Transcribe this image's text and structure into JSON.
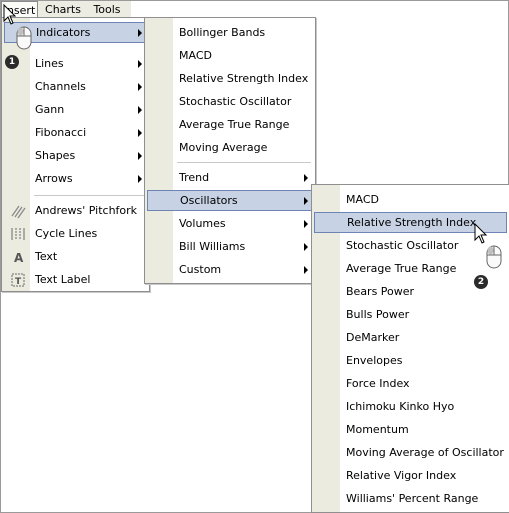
{
  "menubar": {
    "items": [
      "Insert",
      "Charts",
      "Tools"
    ]
  },
  "insert_menu": {
    "items": [
      {
        "label": "Indicators",
        "submenu": true,
        "highlighted": true
      },
      {
        "label": "Lines",
        "submenu": true
      },
      {
        "label": "Channels",
        "submenu": true
      },
      {
        "label": "Gann",
        "submenu": true
      },
      {
        "label": "Fibonacci",
        "submenu": true
      },
      {
        "label": "Shapes",
        "submenu": true
      },
      {
        "label": "Arrows",
        "submenu": true
      },
      {
        "label": "Andrews' Pitchfork",
        "icon": "pitchfork-icon"
      },
      {
        "label": "Cycle Lines",
        "icon": "cycle-lines-icon"
      },
      {
        "label": "Text",
        "icon": "text-icon"
      },
      {
        "label": "Text Label",
        "icon": "text-label-icon"
      }
    ]
  },
  "indicators_menu": {
    "items": [
      {
        "label": "Bollinger Bands"
      },
      {
        "label": "MACD"
      },
      {
        "label": "Relative Strength Index"
      },
      {
        "label": "Stochastic Oscillator"
      },
      {
        "label": "Average True Range"
      },
      {
        "label": "Moving Average"
      },
      {
        "label": "Trend",
        "submenu": true
      },
      {
        "label": "Oscillators",
        "submenu": true,
        "highlighted": true
      },
      {
        "label": "Volumes",
        "submenu": true
      },
      {
        "label": "Bill Williams",
        "submenu": true
      },
      {
        "label": "Custom",
        "submenu": true
      }
    ]
  },
  "oscillators_menu": {
    "items": [
      {
        "label": "MACD"
      },
      {
        "label": "Relative Strength Index",
        "highlighted": true
      },
      {
        "label": "Stochastic Oscillator"
      },
      {
        "label": "Average True Range"
      },
      {
        "label": "Bears Power"
      },
      {
        "label": "Bulls Power"
      },
      {
        "label": "DeMarker"
      },
      {
        "label": "Envelopes"
      },
      {
        "label": "Force Index"
      },
      {
        "label": "Ichimoku Kinko Hyo"
      },
      {
        "label": "Momentum"
      },
      {
        "label": "Moving Average of Oscillator"
      },
      {
        "label": "Relative Vigor Index"
      },
      {
        "label": "Williams' Percent Range"
      }
    ]
  },
  "annotations": {
    "step1": "1",
    "step2": "2"
  },
  "colors": {
    "gutter": "#ecebe0",
    "highlight_fill": "#c7d2e4",
    "highlight_border": "#6e84b4"
  }
}
